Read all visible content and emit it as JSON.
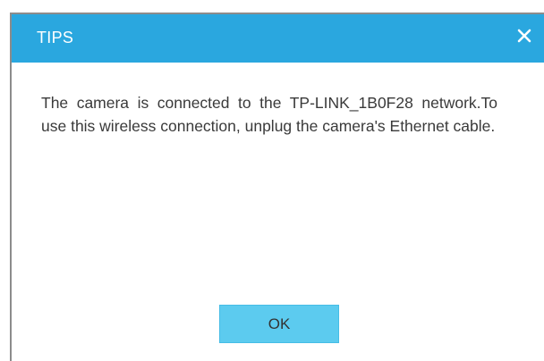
{
  "dialog": {
    "title": "TIPS",
    "close_icon": "close-icon",
    "message": "The camera is connected to the TP-LINK_1B0F28 network.To use this wireless connection, unplug the camera's Ethernet cable.",
    "ok_label": "OK"
  },
  "colors": {
    "titlebar": "#2aa7df",
    "ok_button": "#5ccbef",
    "text": "#3a3a3a"
  }
}
